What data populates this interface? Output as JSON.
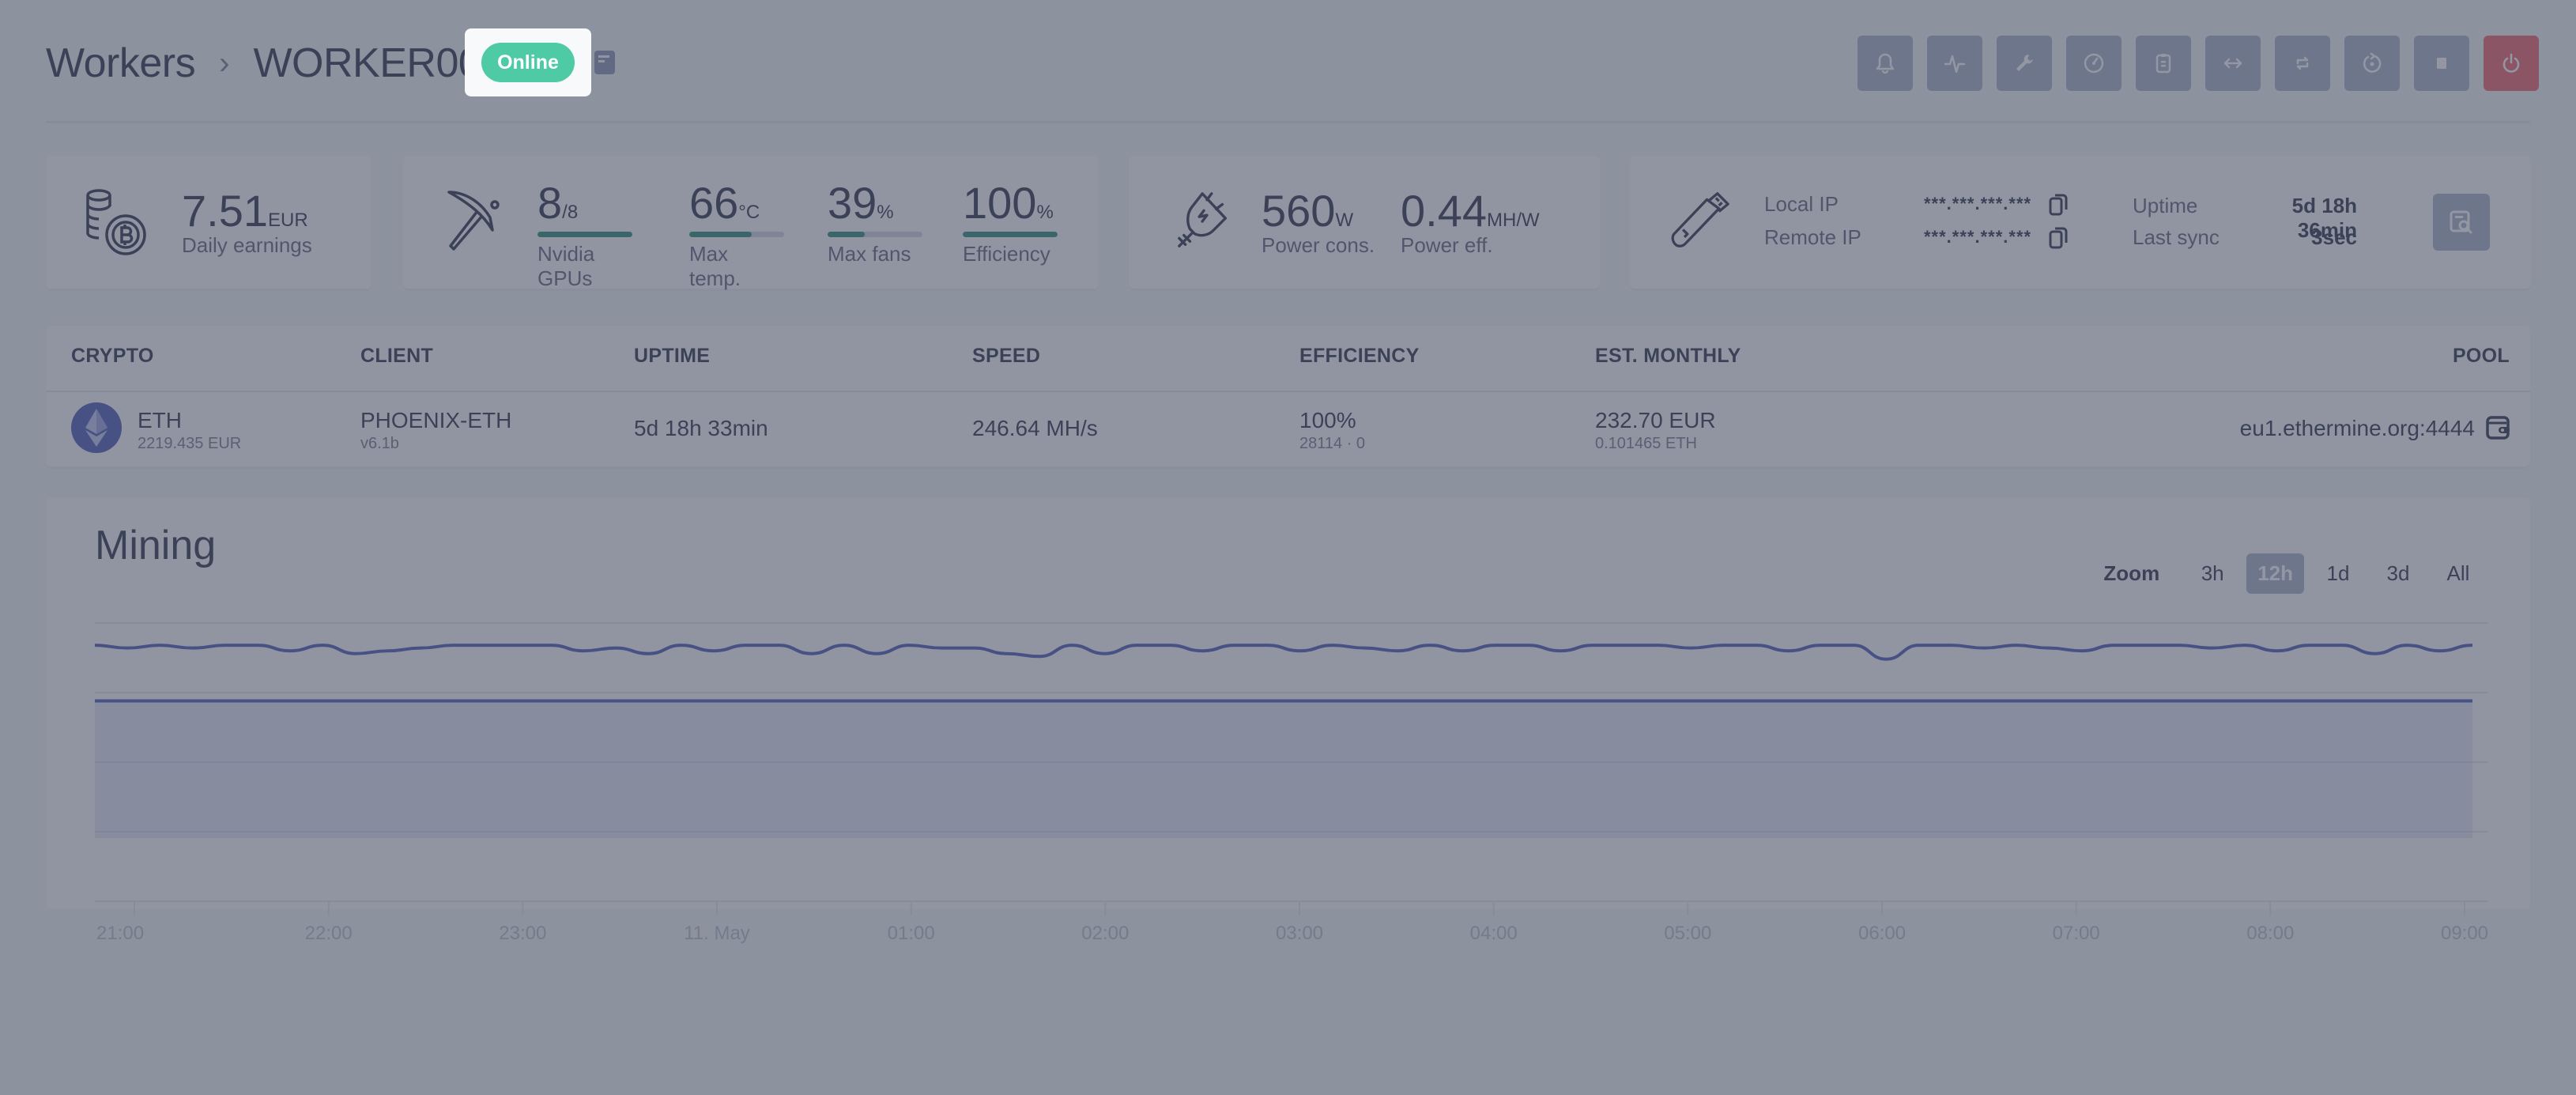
{
  "header": {
    "breadcrumb_root": "Workers",
    "breadcrumb_sep": "›",
    "worker_name": "WORKER001",
    "status_badge": "Online",
    "colors": {
      "online": "#4ecba4",
      "danger": "#f17b83",
      "accent": "#6673c0"
    }
  },
  "toolbar": {
    "buttons": [
      {
        "name": "notifications",
        "icon": "bell-icon"
      },
      {
        "name": "activity",
        "icon": "pulse-icon"
      },
      {
        "name": "settings",
        "icon": "wrench-icon"
      },
      {
        "name": "overclock",
        "icon": "speedometer-icon"
      },
      {
        "name": "logs",
        "icon": "clipboard-icon"
      },
      {
        "name": "transfer",
        "icon": "arrows-horizontal-icon"
      },
      {
        "name": "sync",
        "icon": "refresh-icon"
      },
      {
        "name": "restart",
        "icon": "reboot-icon"
      },
      {
        "name": "stop",
        "icon": "stop-icon"
      },
      {
        "name": "shutdown",
        "icon": "power-icon"
      }
    ]
  },
  "stats": {
    "earnings": {
      "value": "7.51",
      "unit": "EUR",
      "label": "Daily earnings"
    },
    "gpus": {
      "value": "8",
      "unit": "/8",
      "label": "Nvidia GPUs",
      "fill": 1.0
    },
    "temp": {
      "value": "66",
      "unit": "°C",
      "label": "Max temp.",
      "fill": 0.66
    },
    "fans": {
      "value": "39",
      "unit": "%",
      "label": "Max fans",
      "fill": 0.39
    },
    "efficiency": {
      "value": "100",
      "unit": "%",
      "label": "Efficiency",
      "fill": 1.0
    },
    "power": {
      "value": "560",
      "unit": "W",
      "label": "Power cons."
    },
    "power_eff": {
      "value": "0.44",
      "unit": "MH/W",
      "label": "Power eff."
    },
    "network": {
      "local_ip_label": "Local IP",
      "local_ip_value": "***.***.***.***",
      "remote_ip_label": "Remote IP",
      "remote_ip_value": "***.***.***.***",
      "uptime_label": "Uptime",
      "uptime_value": "5d 18h 36min",
      "last_sync_label": "Last sync",
      "last_sync_value": "3sec"
    }
  },
  "table": {
    "headers": [
      "Crypto",
      "Client",
      "Uptime",
      "Speed",
      "Efficiency",
      "Est. Monthly",
      "Pool"
    ],
    "rows": [
      {
        "crypto": "ETH",
        "crypto_sub": "2219.435 EUR",
        "client": "PHOENIX-ETH",
        "client_sub": "v6.1b",
        "uptime": "5d 18h 33min",
        "speed": "246.64 MH/s",
        "efficiency": "100%",
        "efficiency_sub": "28114 · 0",
        "monthly": "232.70 EUR",
        "monthly_sub": "0.101465 ETH",
        "pool": "eu1.ethermine.org:4444"
      }
    ]
  },
  "mining": {
    "title": "Mining",
    "zoom_label": "Zoom",
    "zoom_options": [
      "3h",
      "12h",
      "1d",
      "3d",
      "All"
    ],
    "zoom_selected": "12h"
  },
  "chart_data": {
    "type": "line",
    "title": "Mining",
    "xlabel": "",
    "ylabel": "",
    "x_ticks": [
      "21:00",
      "22:00",
      "23:00",
      "11. May",
      "01:00",
      "02:00",
      "03:00",
      "04:00",
      "05:00",
      "06:00",
      "07:00",
      "08:00",
      "09:00"
    ],
    "x_range": [
      "20:55",
      "09:05"
    ],
    "y_range": [
      0,
      1
    ],
    "grid": true,
    "legend": "none",
    "series": [
      {
        "name": "hashrate",
        "color": "#6673c0",
        "values": [
          0.92,
          0.91,
          0.92,
          0.91,
          0.92,
          0.92,
          0.9,
          0.92,
          0.89,
          0.9,
          0.91,
          0.92,
          0.92,
          0.92,
          0.92,
          0.9,
          0.91,
          0.89,
          0.92,
          0.9,
          0.92,
          0.92,
          0.89,
          0.92,
          0.89,
          0.92,
          0.91,
          0.91,
          0.89,
          0.88,
          0.92,
          0.89,
          0.92,
          0.92,
          0.9,
          0.92,
          0.92,
          0.9,
          0.92,
          0.91,
          0.9,
          0.92,
          0.9,
          0.92,
          0.92,
          0.9,
          0.92,
          0.92,
          0.92,
          0.91,
          0.92,
          0.92,
          0.9,
          0.92,
          0.92,
          0.87,
          0.92,
          0.92,
          0.91,
          0.92,
          0.91,
          0.9,
          0.92,
          0.92,
          0.92,
          0.91,
          0.92,
          0.9,
          0.92,
          0.92,
          0.89,
          0.92,
          0.9,
          0.92
        ]
      },
      {
        "name": "reported",
        "color": "#6673c0",
        "fill": true,
        "values": [
          0.72,
          0.72
        ]
      }
    ]
  }
}
